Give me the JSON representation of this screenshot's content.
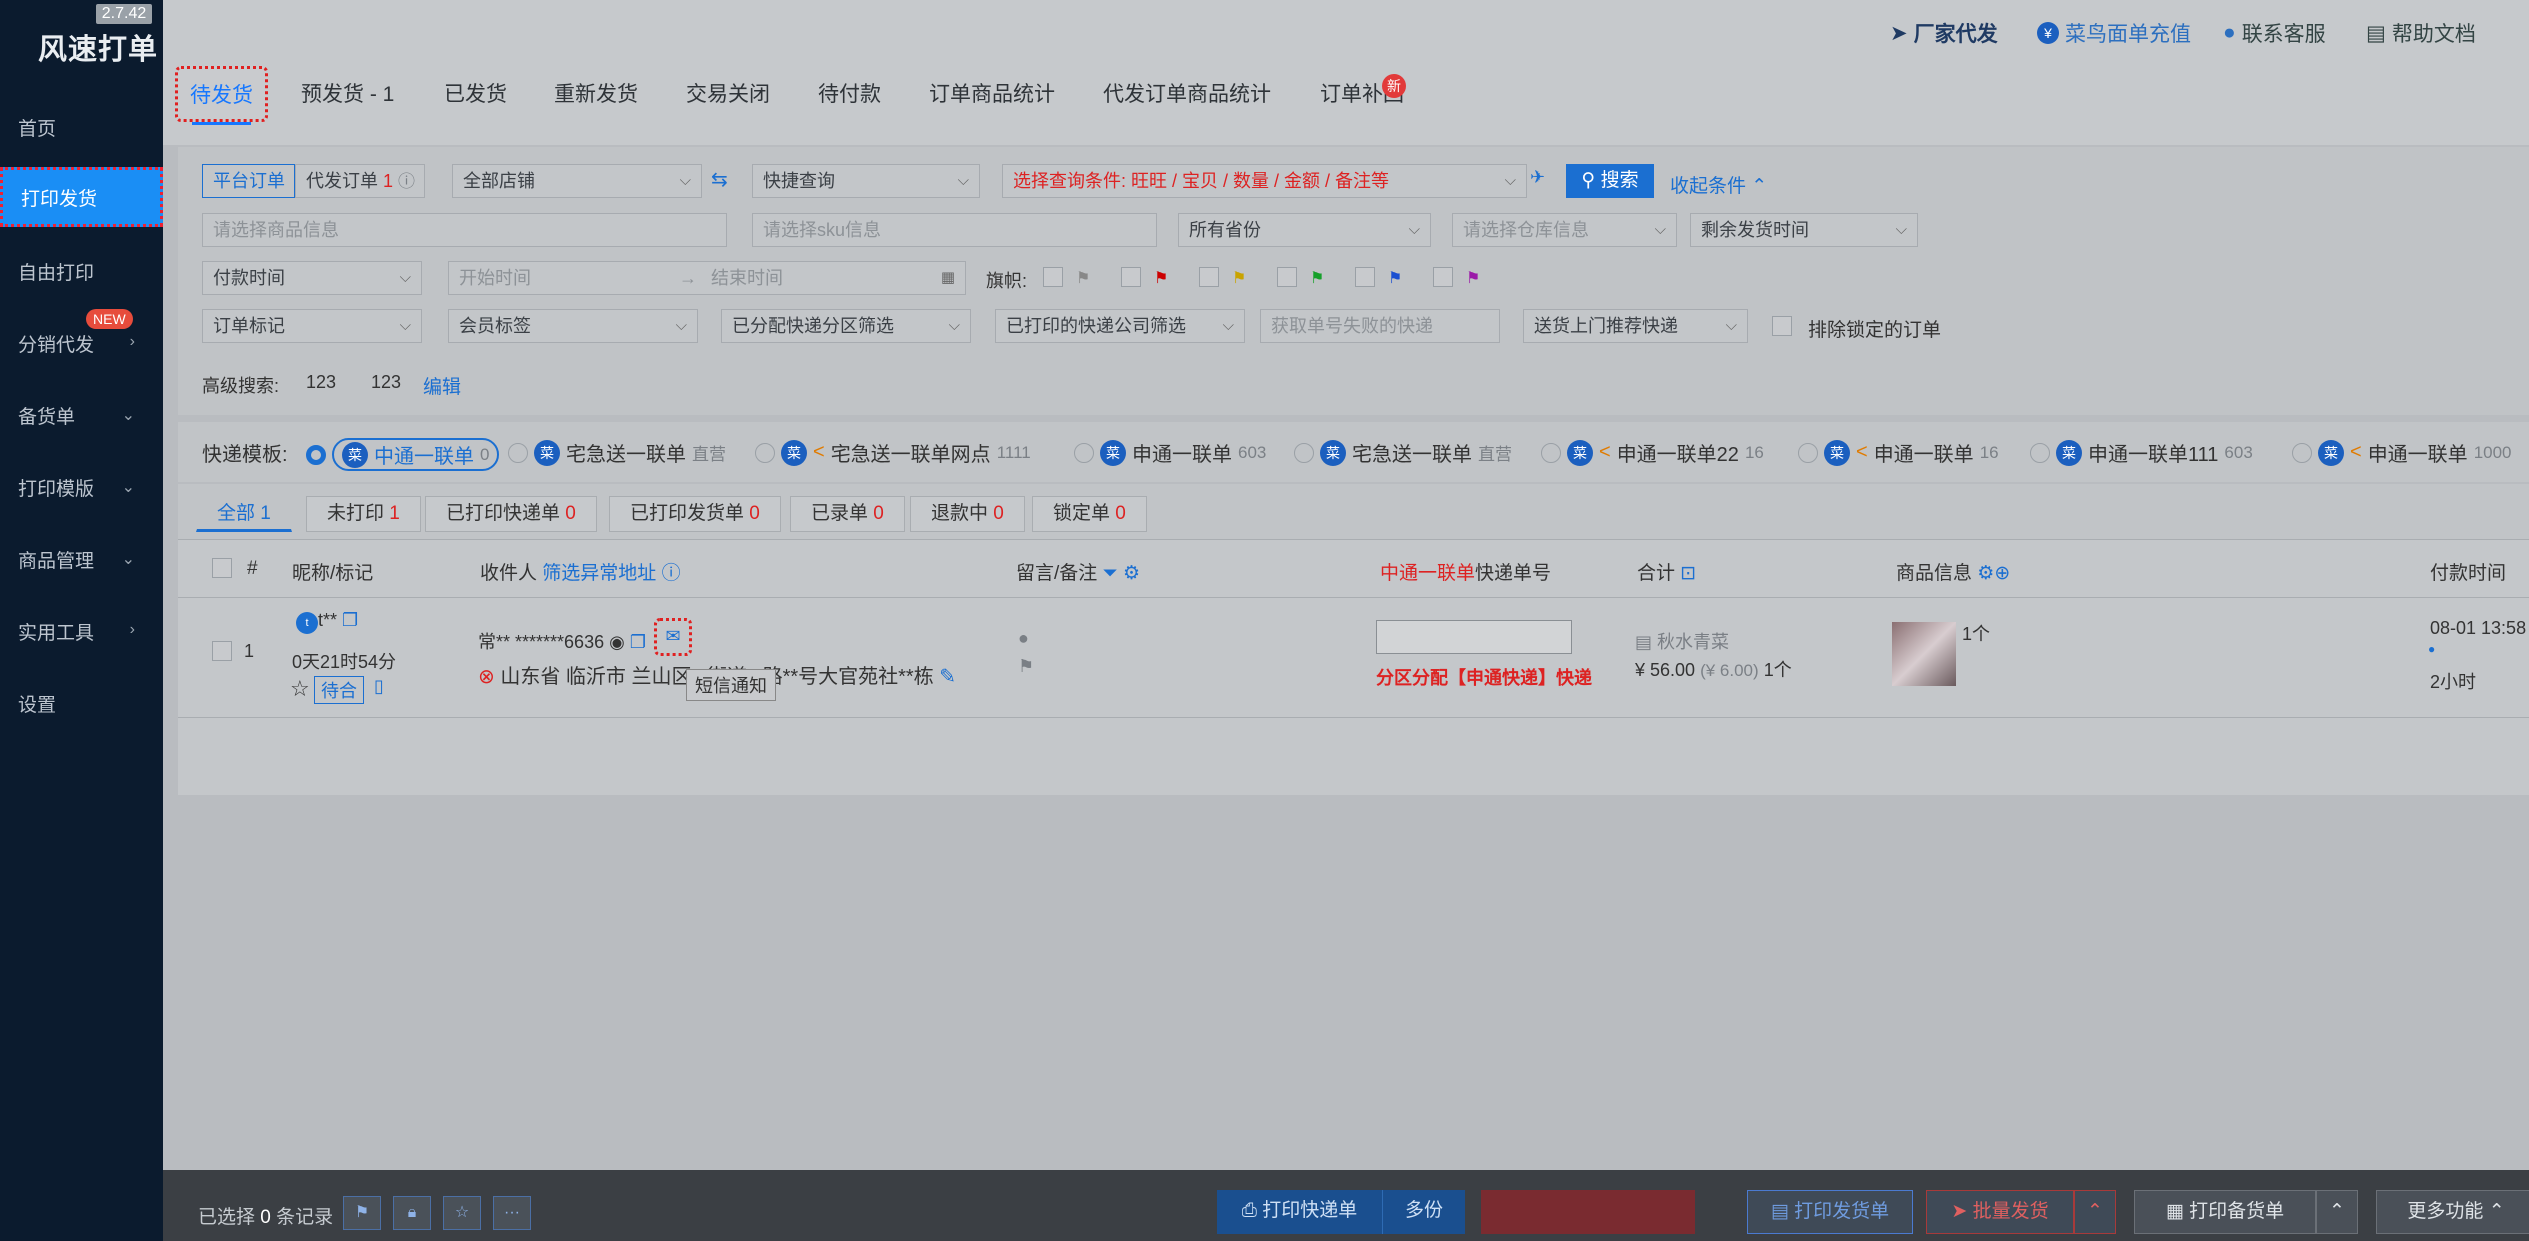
{
  "app": {
    "version": "2.7.42",
    "logo": "风速打单"
  },
  "sidebar": {
    "items": [
      {
        "label": "首页"
      },
      {
        "label": "打印发货",
        "active": true
      },
      {
        "label": "自由打印"
      },
      {
        "label": "分销代发",
        "badge": "NEW",
        "arrow": "›"
      },
      {
        "label": "备货单",
        "arrow": "⌄"
      },
      {
        "label": "打印模版",
        "arrow": "⌄"
      },
      {
        "label": "商品管理",
        "arrow": "⌄"
      },
      {
        "label": "实用工具",
        "arrow": "›"
      },
      {
        "label": "设置"
      }
    ]
  },
  "toplinks": [
    {
      "label": "厂家代发"
    },
    {
      "label": "菜鸟面单充值"
    },
    {
      "label": "联系客服"
    },
    {
      "label": "帮助文档"
    }
  ],
  "tabs": [
    "待发货",
    "预发货 - 1",
    "已发货",
    "重新发货",
    "交易关闭",
    "待付款",
    "订单商品统计",
    "代发订单商品统计",
    "订单补回"
  ],
  "tab_badge": "新",
  "filters": {
    "platform_order": "平台订单",
    "proxy_order": "代发订单",
    "proxy_count": "1",
    "shop": "全部店铺",
    "quick": "快捷查询",
    "condition": "选择查询条件: 旺旺 / 宝贝 / 数量 / 金额 / 备注等",
    "search": "搜索",
    "collapse": "收起条件",
    "goods_ph": "请选择商品信息",
    "sku_ph": "请选择sku信息",
    "province": "所有省份",
    "warehouse_ph": "请选择仓库信息",
    "remain_time": "剩余发货时间",
    "pay_time": "付款时间",
    "start_ph": "开始时间",
    "end_ph": "结束时间",
    "flag_label": "旗帜:",
    "order_mark": "订单标记",
    "member_tag": "会员标签",
    "zone": "已分配快递分区筛选",
    "printed_courier": "已打印的快递公司筛选",
    "fail_ph": "获取单号失败的快递",
    "door": "送货上门推荐快递",
    "exclude_locked": "排除锁定的订单",
    "adv_label": "高级搜索:",
    "adv1": "123",
    "adv2": "123",
    "edit": "编辑"
  },
  "templates": {
    "label": "快递模板:",
    "items": [
      {
        "name": "中通一联单",
        "count": "0",
        "selected": true
      },
      {
        "name": "宅急送一联单",
        "count": "直营"
      },
      {
        "name": "宅急送一联单网点",
        "count": "1111",
        "share": true
      },
      {
        "name": "申通一联单",
        "count": "603"
      },
      {
        "name": "宅急送一联单",
        "count": "直营"
      },
      {
        "name": "申通一联单22",
        "count": "16",
        "share": true
      },
      {
        "name": "申通一联单",
        "count": "16",
        "share": true
      },
      {
        "name": "申通一联单111",
        "count": "603"
      },
      {
        "name": "申通一联单",
        "count": "1000",
        "share": true
      }
    ]
  },
  "subtabs": [
    {
      "label": "全部",
      "count": "1"
    },
    {
      "label": "未打印",
      "count": "1"
    },
    {
      "label": "已打印快递单",
      "count": "0"
    },
    {
      "label": "已打印发货单",
      "count": "0"
    },
    {
      "label": "已录单",
      "count": "0"
    },
    {
      "label": "退款中",
      "count": "0"
    },
    {
      "label": "锁定单",
      "count": "0"
    }
  ],
  "table": {
    "headers": {
      "num": "#",
      "nick": "昵称/标记",
      "receiver": "收件人",
      "filter_addr": "筛选异常地址",
      "message": "留言/备注",
      "courier_red": "中通一联单",
      "courier": "快递单号",
      "total": "合计",
      "goods": "商品信息",
      "paytime": "付款时间"
    },
    "row": {
      "index": "1",
      "nick": "t**",
      "remain": "0天21时54分",
      "tag": "待合",
      "receiver": "常** *******6636",
      "address": "山东省 临沂市 兰山区**街道**路**号大官苑社**栋",
      "tooltip": "短信通知",
      "zone": "分区分配【申通快递】快递",
      "shop": "秋水青菜",
      "price": "¥ 56.00",
      "unit": "(¥ 6.00)",
      "qty": "1个",
      "goods_qty": "1个",
      "pay": "08-01 13:58",
      "pay_rel": "2小时"
    }
  },
  "bottom": {
    "selected_prefix": "已选择",
    "selected_count": "0",
    "selected_suffix": "条记录",
    "print_courier": "打印快递单",
    "multi": "多份",
    "print_ship": "打印发货单",
    "batch_ship": "批量发货",
    "print_stock": "打印备货单",
    "more": "更多功能"
  }
}
